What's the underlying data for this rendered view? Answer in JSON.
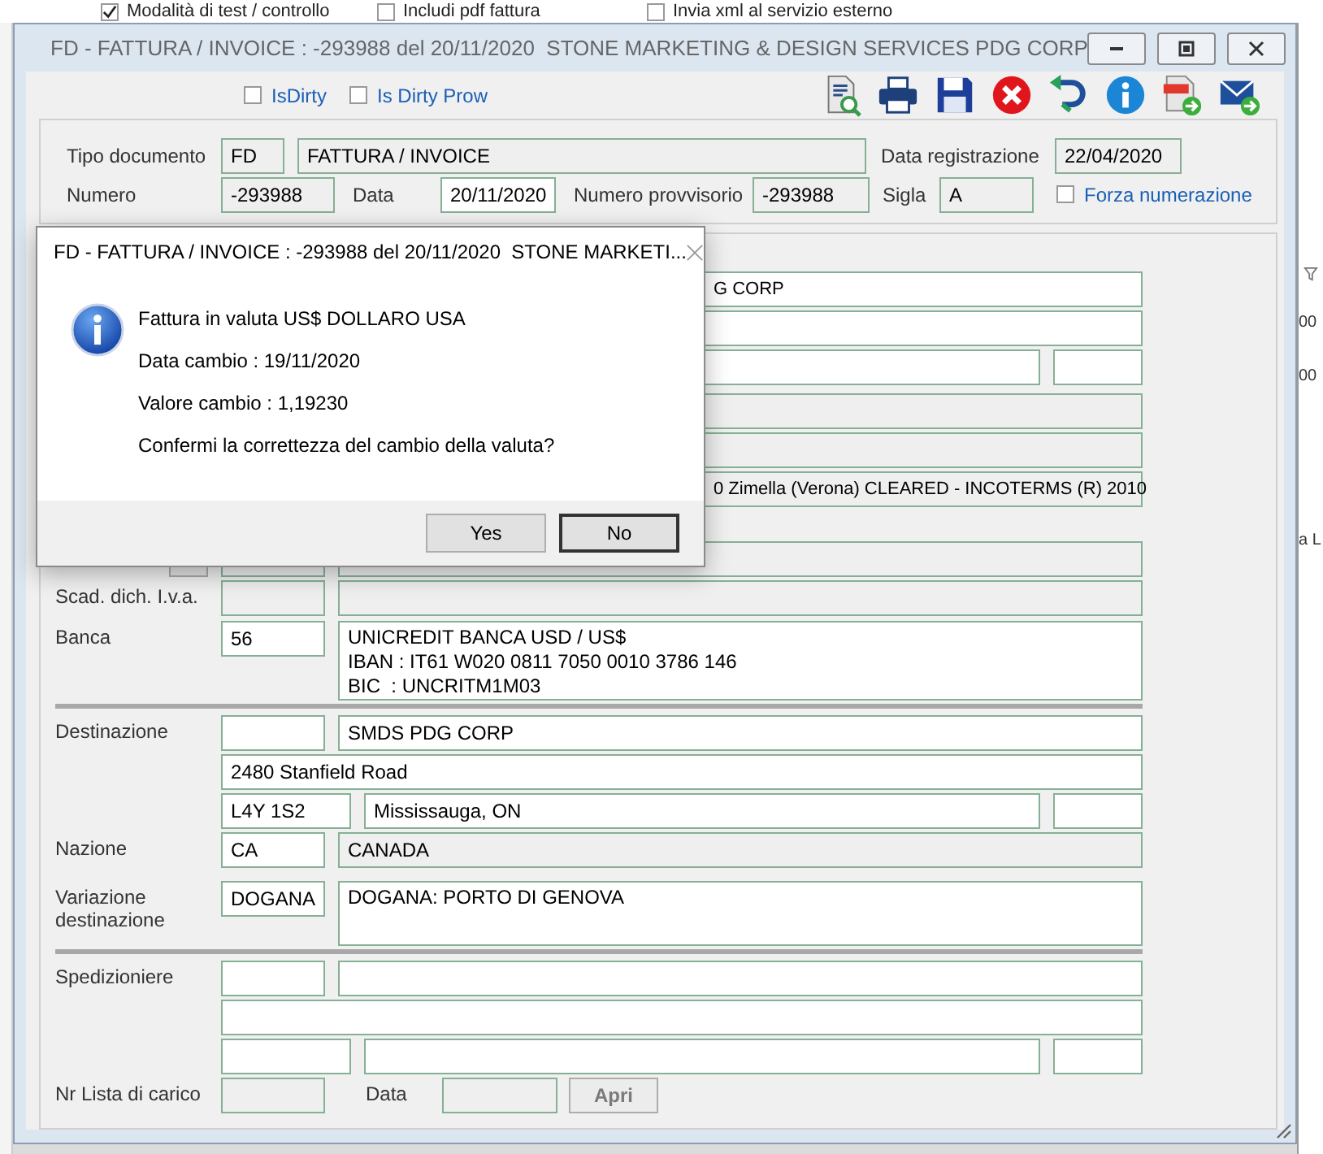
{
  "background_window": {
    "options": [
      {
        "label": "Modalità di test / controllo",
        "checked": true
      },
      {
        "label": "Includi pdf fattura",
        "checked": false
      },
      {
        "label": "Invia xml al servizio esterno",
        "checked": false
      }
    ],
    "edge_texts": [
      "00",
      "00",
      "a L"
    ]
  },
  "window": {
    "title": "FD - FATTURA / INVOICE : -293988 del 20/11/2020  STONE MARKETING & DESIGN SERVICES PDG CORP"
  },
  "flags": [
    {
      "label": "IsDirty",
      "checked": false
    },
    {
      "label": "Is Dirty Prow",
      "checked": false
    }
  ],
  "header": {
    "tipo_documento": {
      "label": "Tipo documento",
      "code": {
        "value": "FD",
        "readonly": true
      },
      "description": {
        "value": "FATTURA / INVOICE",
        "readonly": true
      }
    },
    "data_registrazione": {
      "label": "Data registrazione",
      "value": "22/04/2020",
      "readonly": true
    },
    "numero": {
      "label": "Numero",
      "value": "-293988",
      "readonly": true
    },
    "data": {
      "label": "Data",
      "value": "20/11/2020",
      "readonly": false
    },
    "numero_provvisorio": {
      "label": "Numero provvisorio",
      "value": "-293988",
      "readonly": true
    },
    "sigla": {
      "label": "Sigla",
      "value": "A",
      "readonly": true
    },
    "forza_numerazione": {
      "label": "Forza numerazione",
      "checked": false
    }
  },
  "form": {
    "groups": [
      {
        "blocks": [
          {
            "rows": [
              {
                "fields": [
                  {
                    "kind": "name",
                    "value": "G CORP",
                    "readonly": false
                  }
                ]
              },
              {
                "fields": [
                  {
                    "kind": "name",
                    "readonly": false
                  }
                ]
              },
              {
                "fields": [
                  {
                    "kind": "name_short",
                    "readonly": false
                  },
                  {
                    "kind": "extra",
                    "readonly": false
                  }
                ]
              }
            ]
          },
          {
            "rows": [
              {
                "fields": [
                  {
                    "kind": "name",
                    "readonly": true
                  }
                ]
              },
              {
                "fields": [
                  {
                    "kind": "name",
                    "readonly": true
                  }
                ]
              },
              {
                "fields": [
                  {
                    "kind": "name",
                    "value": "0 Zimella (Verona) CLEARED - INCOTERMS (R) 2010",
                    "readonly": true
                  }
                ]
              }
            ]
          },
          {
            "rows": [
              {
                "lead_button": true,
                "fields": [
                  {
                    "kind": "code",
                    "readonly": true
                  },
                  {
                    "kind": "name",
                    "readonly": true
                  }
                ]
              },
              {
                "label": "Scad. dich. I.v.a.",
                "fields": [
                  {
                    "kind": "code",
                    "readonly": true
                  },
                  {
                    "kind": "name",
                    "readonly": true
                  }
                ]
              }
            ]
          },
          {
            "rows": [
              {
                "label": "Banca",
                "fields": [
                  {
                    "kind": "code",
                    "value": "56",
                    "readonly": false
                  },
                  {
                    "kind": "text_area",
                    "lines": [
                      "UNICREDIT BANCA USD / US$",
                      "IBAN : IT61 W020 0811 7050 0010 3786 146",
                      "BIC  : UNCRITM1M03"
                    ],
                    "readonly": false
                  }
                ]
              }
            ]
          }
        ]
      },
      {
        "blocks": [
          {
            "rows": [
              {
                "label": "Destinazione",
                "fields": [
                  {
                    "kind": "code",
                    "readonly": false
                  },
                  {
                    "kind": "name",
                    "value": "SMDS PDG CORP",
                    "readonly": false
                  }
                ]
              },
              {
                "fields": [
                  {
                    "kind": "address",
                    "value": "2480 Stanfield Road",
                    "readonly": false
                  }
                ]
              },
              {
                "fields": [
                  {
                    "kind": "zip",
                    "value": "L4Y 1S2",
                    "readonly": false
                  },
                  {
                    "kind": "city",
                    "value": "Mississauga, ON",
                    "readonly": false
                  },
                  {
                    "kind": "extra",
                    "readonly": false
                  }
                ]
              },
              {
                "label": "Nazione",
                "fields": [
                  {
                    "kind": "code",
                    "value": "CA",
                    "readonly": false
                  },
                  {
                    "kind": "name",
                    "value": "CANADA",
                    "readonly": true
                  }
                ]
              }
            ]
          },
          {
            "rows": [
              {
                "label": "Variazione destinazione",
                "fields": [
                  {
                    "kind": "code",
                    "value": "DOGANA",
                    "readonly": false
                  },
                  {
                    "kind": "text_area",
                    "lines": [
                      "DOGANA: PORTO DI GENOVA"
                    ],
                    "readonly": false
                  }
                ]
              }
            ]
          }
        ]
      },
      {
        "blocks": [
          {
            "rows": [
              {
                "label": "Spedizioniere",
                "fields": [
                  {
                    "kind": "code",
                    "readonly": false
                  },
                  {
                    "kind": "name",
                    "readonly": false
                  }
                ]
              },
              {
                "fields": [
                  {
                    "kind": "address",
                    "readonly": false
                  }
                ]
              },
              {
                "fields": [
                  {
                    "kind": "zip",
                    "readonly": false
                  },
                  {
                    "kind": "city",
                    "readonly": false
                  },
                  {
                    "kind": "extra",
                    "readonly": false
                  }
                ]
              },
              {
                "label": "Nr Lista di carico",
                "fields": [
                  {
                    "kind": "code",
                    "readonly": true
                  },
                  {
                    "kind": "caption",
                    "value": "Data"
                  },
                  {
                    "kind": "date",
                    "readonly": true
                  },
                  {
                    "kind": "button",
                    "value": "Apri",
                    "disabled": true
                  }
                ]
              }
            ]
          }
        ]
      }
    ]
  },
  "dialog": {
    "title": "FD - FATTURA / INVOICE : -293988 del 20/11/2020  STONE MARKETI...",
    "messages": [
      "Fattura in valuta US$ DOLLARO USA",
      "Data cambio : 19/11/2020",
      "Valore cambio : 1,19230",
      "Confermi la correttezza del cambio della valuta?"
    ],
    "buttons": [
      {
        "label": "Yes",
        "focused": false
      },
      {
        "label": "No",
        "focused": true
      }
    ]
  }
}
